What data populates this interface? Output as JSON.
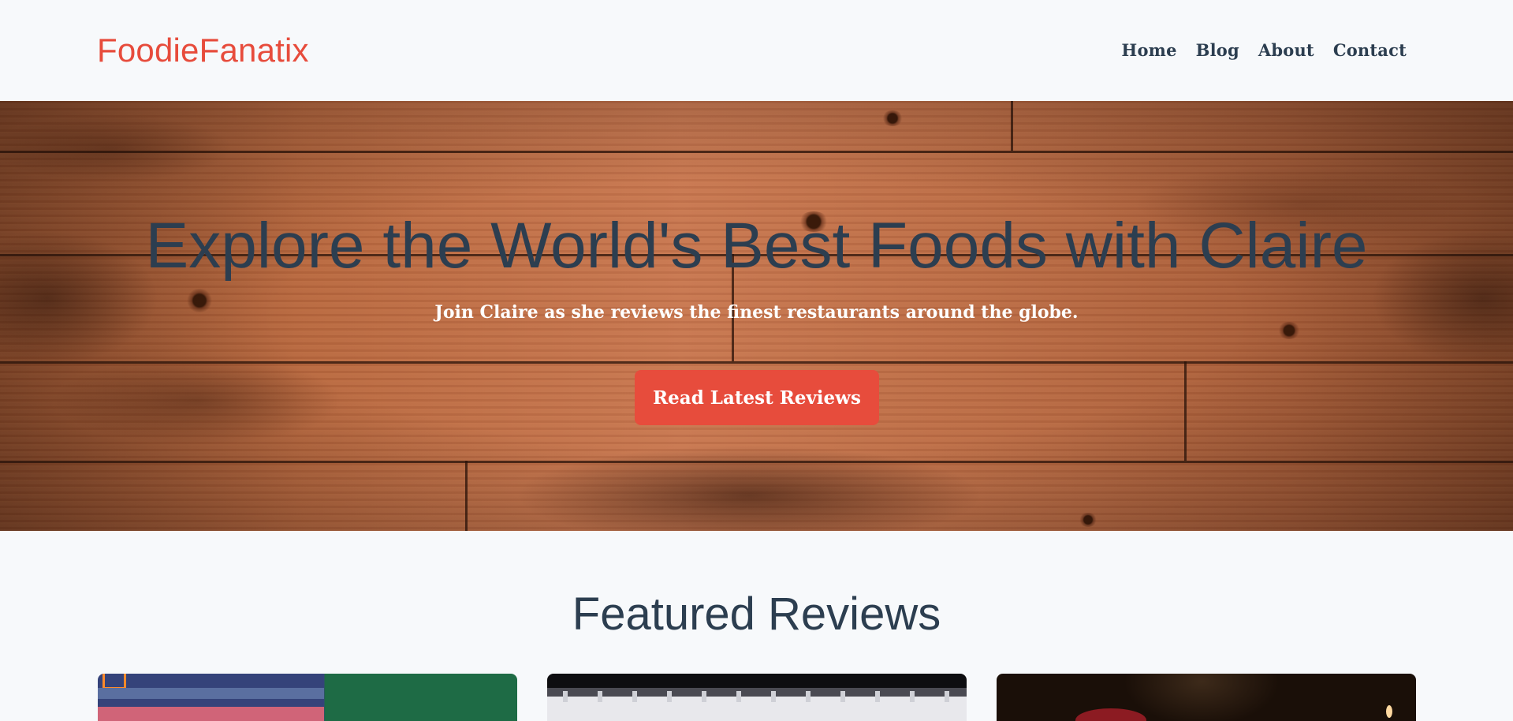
{
  "brand": {
    "name": "FoodieFanatix",
    "color": "#e74c3c"
  },
  "nav": {
    "items": [
      {
        "label": "Home"
      },
      {
        "label": "Blog"
      },
      {
        "label": "About"
      },
      {
        "label": "Contact"
      }
    ]
  },
  "hero": {
    "title": "Explore the World's Best Foods with Claire",
    "subtitle": "Join Claire as she reviews the finest restaurants around the globe.",
    "cta_label": "Read Latest Reviews",
    "background": "wood-planks"
  },
  "featured": {
    "title": "Featured Reviews",
    "cards": [
      {
        "image": "restaurant-neon-storefront"
      },
      {
        "image": "restaurant-curtained-window"
      },
      {
        "image": "dim-restaurant-diner"
      }
    ]
  },
  "colors": {
    "accent": "#e74c3c",
    "text_dark": "#2c3e50",
    "page_bg": "#f7f9fb"
  }
}
